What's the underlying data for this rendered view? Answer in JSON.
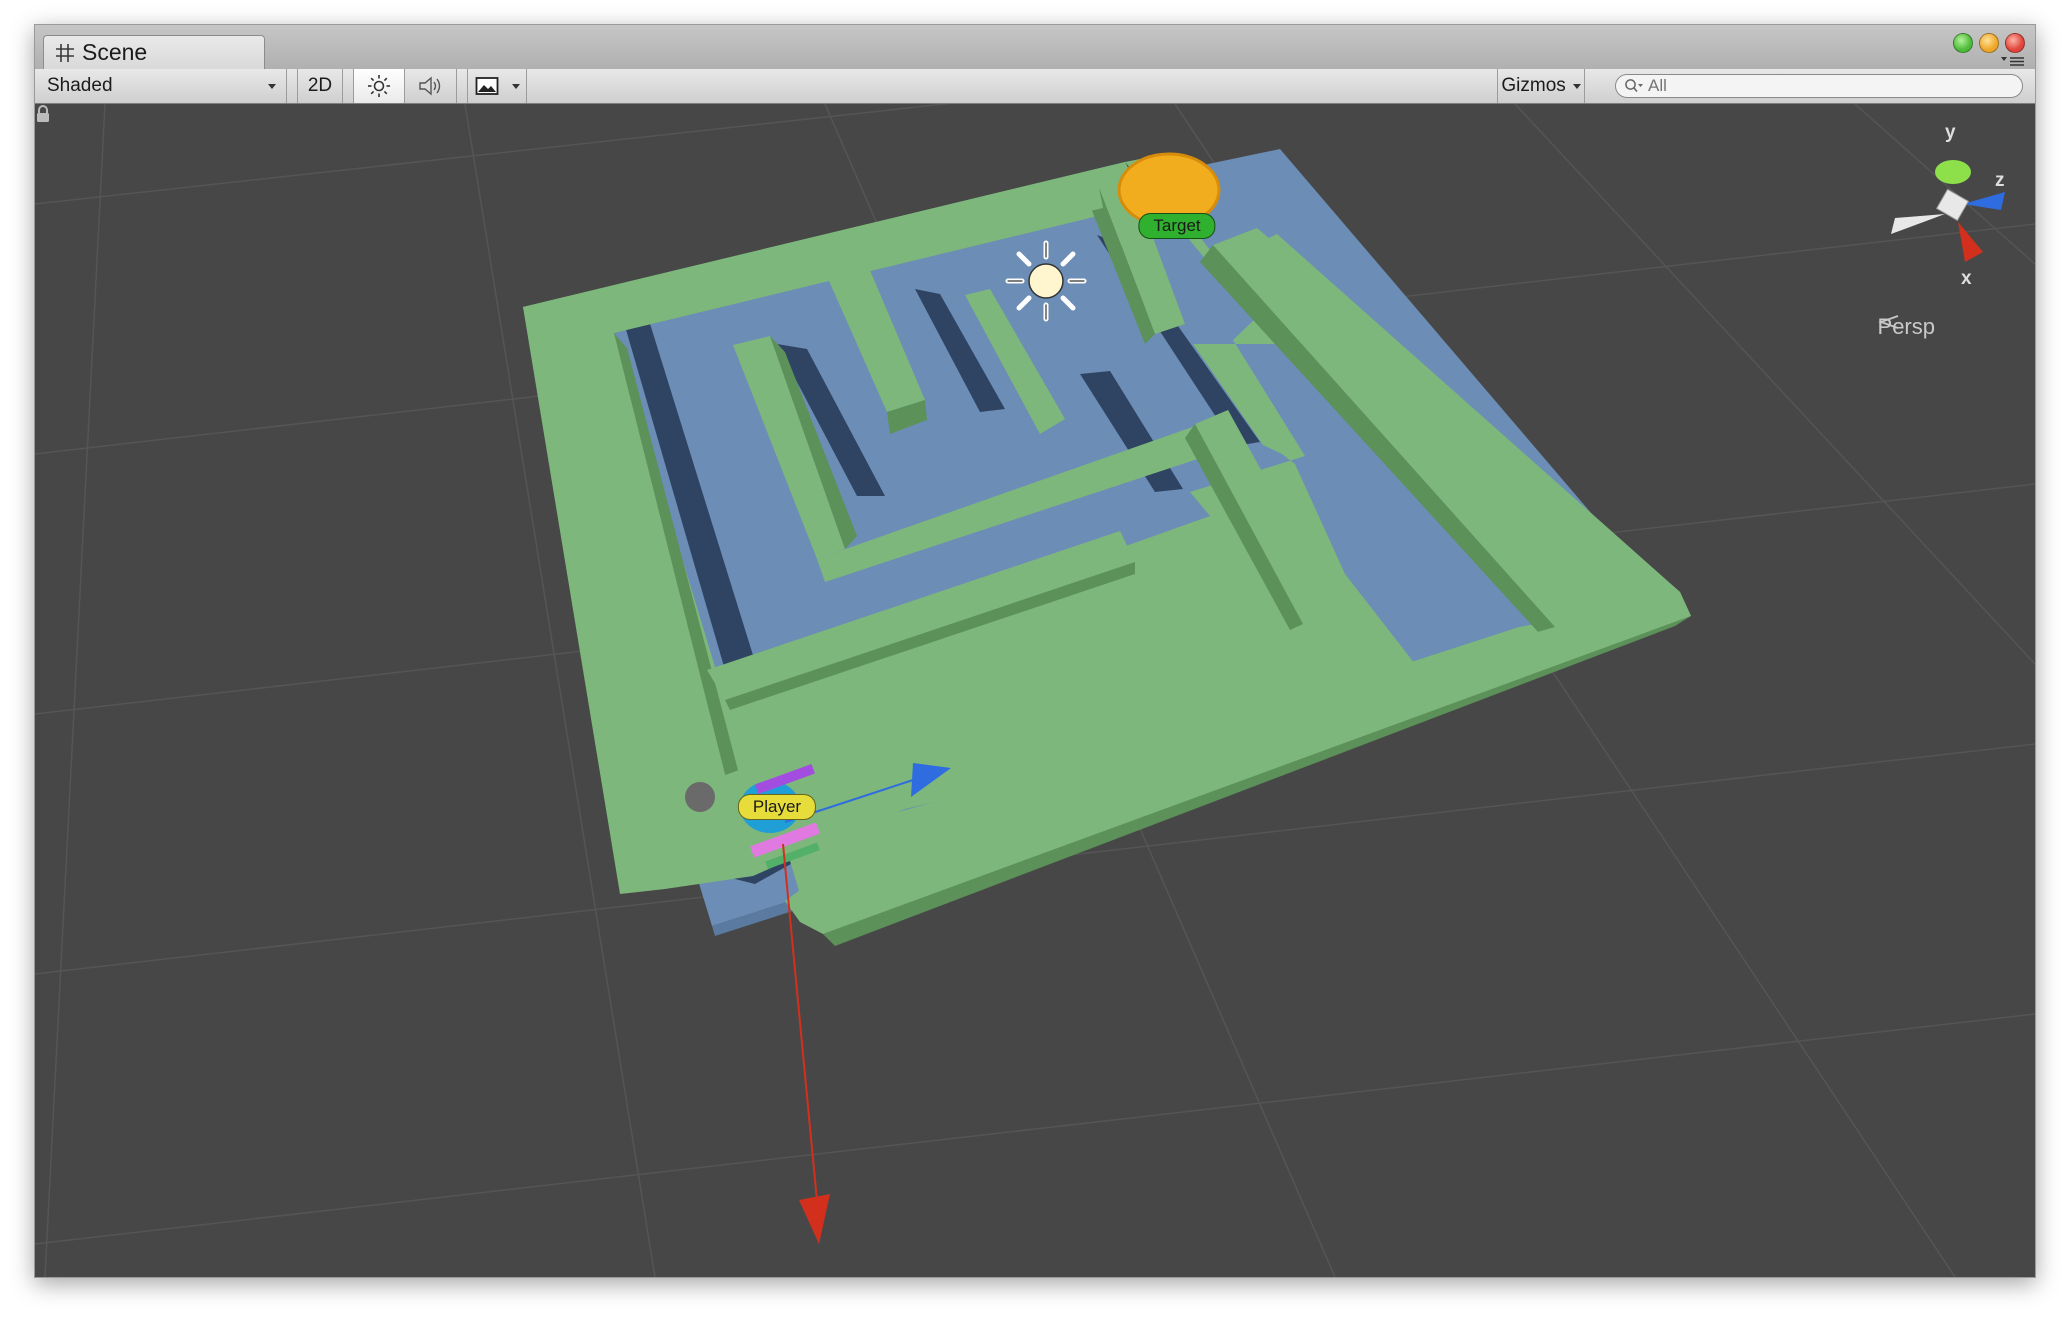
{
  "tab": {
    "title": "Scene",
    "icon": "grid-icon"
  },
  "toolbar": {
    "draw_mode": "Shaded",
    "mode_2d": "2D",
    "lighting_icon": "sun-icon",
    "audio_icon": "speaker-icon",
    "effects_icon": "image-icon",
    "gizmos_label": "Gizmos",
    "search_placeholder": "All",
    "search_icon": "search-icon"
  },
  "window_controls": {
    "colors": [
      "#4fbb3a",
      "#f0a728",
      "#e0443a"
    ]
  },
  "viewport": {
    "projection_label": "Persp",
    "gizmo_axes": {
      "x": "x",
      "y": "y",
      "z": "z"
    },
    "objects": {
      "target_label": "Target",
      "player_label": "Player"
    }
  },
  "colors": {
    "floor": "#6b8db5",
    "wall_top": "#7db77c",
    "wall_side": "#5c9159",
    "background": "#474747",
    "target_label": "#2fb12f",
    "player_label": "#e6dd3a",
    "x_axis": "#d2301d",
    "y_axis": "#8ee04a",
    "z_axis": "#2f6ce0"
  }
}
